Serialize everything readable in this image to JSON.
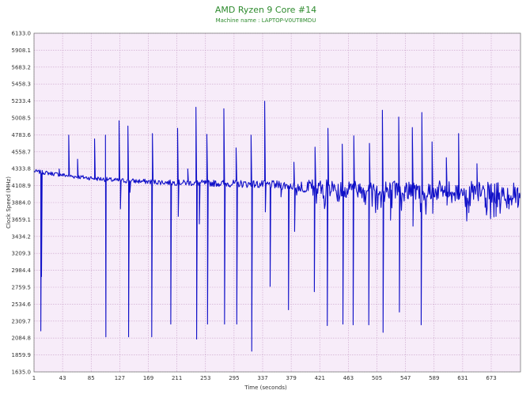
{
  "chart_data": {
    "type": "line",
    "title": "AMD Ryzen 9 Core #14",
    "subtitle": "Machine name : LAPTOP-V0UT8MDU",
    "xlabel": "Time (seconds)",
    "ylabel": "Clock Speed (MHz)",
    "xlim": [
      1,
      716
    ],
    "ylim": [
      1635.0,
      6133.0
    ],
    "x_ticks": [
      1,
      43,
      85,
      127,
      169,
      211,
      253,
      295,
      337,
      379,
      421,
      463,
      505,
      547,
      589,
      631,
      673
    ],
    "y_ticks": [
      "1635.0",
      "1859.9",
      "2084.8",
      "2309.7",
      "2534.6",
      "2759.5",
      "2984.4",
      "3209.3",
      "3434.2",
      "3659.1",
      "3884.0",
      "4108.9",
      "4333.8",
      "4558.7",
      "4783.6",
      "5008.5",
      "5233.4",
      "5458.3",
      "5683.2",
      "5908.1",
      "6133.0"
    ],
    "grid": true,
    "background_color": "#f7ecf9",
    "grid_color": "#c8a0c8",
    "line_color": "#1010c8",
    "title_color": "#2e8b2e",
    "series": [
      {
        "baseline": [
          [
            1,
            4300
          ],
          [
            60,
            4230
          ],
          [
            120,
            4180
          ],
          [
            200,
            4150
          ],
          [
            300,
            4135
          ],
          [
            380,
            4110
          ],
          [
            430,
            4080
          ],
          [
            500,
            4060
          ],
          [
            560,
            4050
          ],
          [
            640,
            4030
          ],
          [
            716,
            3990
          ]
        ],
        "noise": [
          [
            1,
            25
          ],
          [
            200,
            35
          ],
          [
            380,
            60
          ],
          [
            420,
            110
          ],
          [
            716,
            150
          ]
        ],
        "spikes": [
          {
            "x": 11,
            "y": 2180
          },
          {
            "x": 12,
            "y": 2900
          },
          {
            "x": 38,
            "y": 4330
          },
          {
            "x": 52,
            "y": 4780
          },
          {
            "x": 65,
            "y": 4460
          },
          {
            "x": 90,
            "y": 4730
          },
          {
            "x": 106,
            "y": 4780
          },
          {
            "x": 106.6,
            "y": 2100
          },
          {
            "x": 126,
            "y": 4970
          },
          {
            "x": 128,
            "y": 3800
          },
          {
            "x": 142,
            "y": 4020
          },
          {
            "x": 139,
            "y": 4900
          },
          {
            "x": 140,
            "y": 2100
          },
          {
            "x": 174,
            "y": 2100
          },
          {
            "x": 175,
            "y": 4800
          },
          {
            "x": 202,
            "y": 2270
          },
          {
            "x": 212,
            "y": 4870
          },
          {
            "x": 213,
            "y": 3700
          },
          {
            "x": 227,
            "y": 4330
          },
          {
            "x": 239,
            "y": 5150
          },
          {
            "x": 240,
            "y": 2070
          },
          {
            "x": 244,
            "y": 3600
          },
          {
            "x": 255,
            "y": 4790
          },
          {
            "x": 256,
            "y": 2270
          },
          {
            "x": 280,
            "y": 5130
          },
          {
            "x": 281,
            "y": 2270
          },
          {
            "x": 298,
            "y": 4610
          },
          {
            "x": 299,
            "y": 2270
          },
          {
            "x": 320,
            "y": 4780
          },
          {
            "x": 321,
            "y": 1910
          },
          {
            "x": 340,
            "y": 5230
          },
          {
            "x": 341,
            "y": 3760
          },
          {
            "x": 348,
            "y": 2770
          },
          {
            "x": 364,
            "y": 3960
          },
          {
            "x": 375,
            "y": 2460
          },
          {
            "x": 383,
            "y": 4420
          },
          {
            "x": 384,
            "y": 3500
          },
          {
            "x": 398,
            "y": 4040
          },
          {
            "x": 413,
            "y": 2700
          },
          {
            "x": 414,
            "y": 4620
          },
          {
            "x": 432,
            "y": 2250
          },
          {
            "x": 433,
            "y": 4870
          },
          {
            "x": 454,
            "y": 4660
          },
          {
            "x": 455,
            "y": 2270
          },
          {
            "x": 470,
            "y": 2260
          },
          {
            "x": 471,
            "y": 4770
          },
          {
            "x": 493,
            "y": 2260
          },
          {
            "x": 494,
            "y": 4670
          },
          {
            "x": 513,
            "y": 5110
          },
          {
            "x": 514,
            "y": 2160
          },
          {
            "x": 525,
            "y": 3650
          },
          {
            "x": 537,
            "y": 5020
          },
          {
            "x": 538,
            "y": 2430
          },
          {
            "x": 557,
            "y": 4880
          },
          {
            "x": 558,
            "y": 3570
          },
          {
            "x": 570,
            "y": 2260
          },
          {
            "x": 571,
            "y": 5080
          },
          {
            "x": 586,
            "y": 4690
          },
          {
            "x": 587,
            "y": 3740
          },
          {
            "x": 607,
            "y": 4480
          },
          {
            "x": 608,
            "y": 3850
          },
          {
            "x": 625,
            "y": 4800
          },
          {
            "x": 640,
            "y": 3750
          },
          {
            "x": 652,
            "y": 4400
          },
          {
            "x": 664,
            "y": 3820
          },
          {
            "x": 680,
            "y": 3700
          },
          {
            "x": 699,
            "y": 3800
          },
          {
            "x": 712,
            "y": 3820
          }
        ]
      }
    ]
  }
}
